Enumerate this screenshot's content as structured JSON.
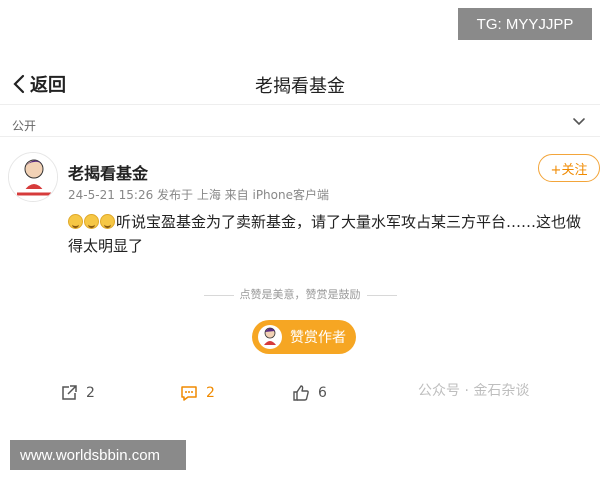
{
  "overlays": {
    "top_right": "TG: MYYJJPP",
    "bottom_left": "www.worldsbbin.com"
  },
  "nav": {
    "back_label": "返回",
    "title": "老揭看基金"
  },
  "visibility": {
    "label": "公开"
  },
  "post": {
    "author": "老揭看基金",
    "meta": "24-5-21 15:26 发布于 上海 来自 iPhone客户端",
    "follow_label": "+关注",
    "text": "听说宝盈基金为了卖新基金，请了大量水军攻占某三方平台……这也做得太明显了",
    "emoji_count": 3
  },
  "reward": {
    "hint": "点赞是美意，赞赏是鼓励",
    "button_label": "赞赏作者"
  },
  "actions": {
    "repost_count": "2",
    "comment_count": "2",
    "like_count": "6"
  },
  "watermark": {
    "text": "公众号 · 金石杂谈"
  },
  "colors": {
    "accent": "#f6a623",
    "follow": "#f08a00",
    "comment_icon": "#f08a00"
  }
}
